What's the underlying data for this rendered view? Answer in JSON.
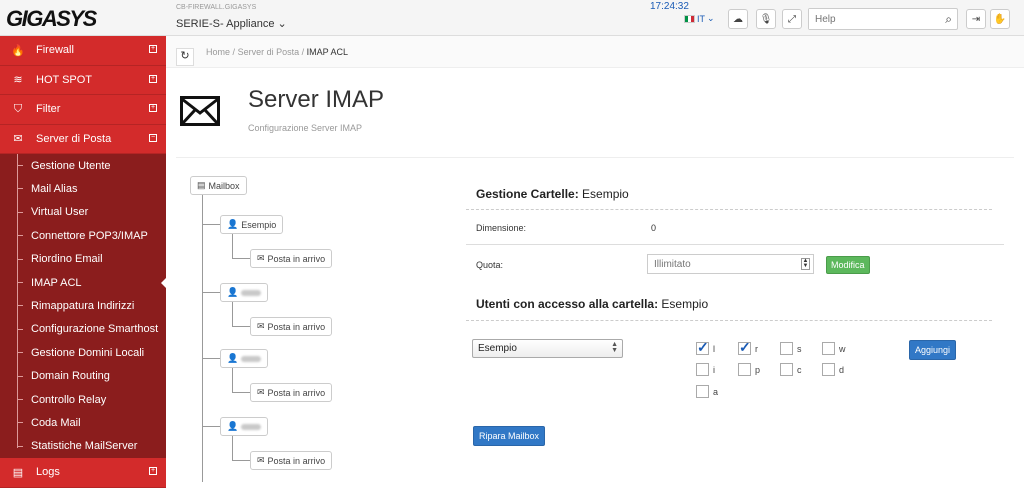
{
  "topbar": {
    "logo": "GIGASYS",
    "device_name": "CB-FIREWALL.GIGASYS",
    "device_series": "SERIE-S- Appliance ⌄",
    "clock": "17:24:32",
    "language": "IT",
    "help_placeholder": "Help",
    "icons": [
      "cloud-icon",
      "microphone-icon",
      "fullscreen-icon",
      "logout-icon",
      "hand-icon"
    ]
  },
  "sidebar": {
    "main_items": [
      {
        "label": "Firewall",
        "icon": "fire-icon",
        "toggle": "+"
      },
      {
        "label": "HOT SPOT",
        "icon": "wifi-icon",
        "toggle": "+"
      },
      {
        "label": "Filter",
        "icon": "shield-icon",
        "toggle": "+"
      },
      {
        "label": "Server di Posta",
        "icon": "envelope-icon",
        "toggle": "−"
      }
    ],
    "sub_items": [
      "Gestione Utente",
      "Mail Alias",
      "Virtual User",
      "Connettore POP3/IMAP",
      "Riordino Email",
      "IMAP ACL",
      "Rimappatura Indirizzi",
      "Configurazione Smarthost",
      "Gestione Domini Locali",
      "Domain Routing",
      "Controllo Relay",
      "Coda Mail",
      "Statistiche MailServer"
    ],
    "active_sub": "IMAP ACL",
    "bottom_item": {
      "label": "Logs",
      "toggle": "+"
    }
  },
  "breadcrumb": {
    "home": "Home",
    "sep": "/",
    "parent": "Server di Posta",
    "current": "IMAP ACL"
  },
  "header": {
    "title": "Server IMAP",
    "subtitle": "Configurazione Server IMAP"
  },
  "tree": {
    "root": "Mailbox",
    "users": [
      "Esempio"
    ],
    "inbox_label": "Posta in arrivo"
  },
  "gestione": {
    "title_bold": "Gestione Cartelle:",
    "title_rest": " Esempio",
    "dimension_label": "Dimensione:",
    "dimension_value": "0",
    "quota_label": "Quota:",
    "quota_placeholder": "Illimitato",
    "modify_button": "Modifica"
  },
  "access": {
    "title_bold": "Utenti con accesso alla cartella:",
    "title_rest": " Esempio",
    "user_select": "Esempio",
    "add_button": "Aggiungi",
    "repair_button": "Ripara Mailbox",
    "permissions": [
      {
        "key": "l",
        "checked": true
      },
      {
        "key": "r",
        "checked": true
      },
      {
        "key": "s",
        "checked": false
      },
      {
        "key": "w",
        "checked": false
      },
      {
        "key": "i",
        "checked": false
      },
      {
        "key": "p",
        "checked": false
      },
      {
        "key": "c",
        "checked": false
      },
      {
        "key": "d",
        "checked": false
      },
      {
        "key": "a",
        "checked": false
      }
    ]
  },
  "colors": {
    "sidebar_dark": "#8b1d1d",
    "sidebar_red": "#d32b2b",
    "accent_blue": "#3178c6",
    "accent_green": "#5cb85c"
  }
}
